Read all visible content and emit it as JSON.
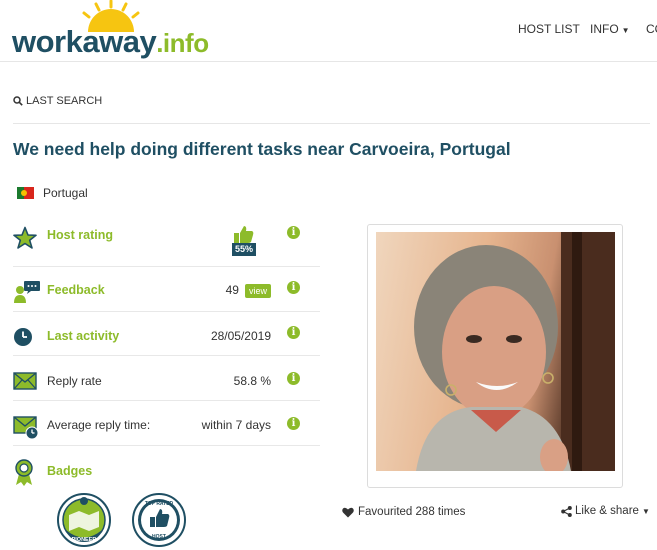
{
  "header": {
    "logo_main": "workaway",
    "logo_suffix": ".info",
    "nav": [
      {
        "label": "HOST LIST",
        "has_caret": false
      },
      {
        "label": "INFO",
        "has_caret": true
      },
      {
        "label": "CO",
        "has_caret": false
      }
    ]
  },
  "last_search": {
    "label": "LAST SEARCH",
    "icon": "search-icon"
  },
  "listing": {
    "title": "We need help doing different tasks near Carvoeira, Portugal",
    "country": "Portugal"
  },
  "stats": {
    "host_rating": {
      "label": "Host rating",
      "percent": "55%"
    },
    "feedback": {
      "label": "Feedback",
      "value": "49",
      "button": "view"
    },
    "last_activity": {
      "label": "Last activity",
      "value": "28/05/2019"
    },
    "reply_rate": {
      "label": "Reply rate",
      "value": "58.8 %"
    },
    "avg_reply": {
      "label": "Average reply time:",
      "value": "within 7 days"
    },
    "badges": {
      "label": "Badges",
      "items": [
        "PIONEER",
        "TOP RATED HOST"
      ]
    }
  },
  "photo": {
    "alt": "host-photo"
  },
  "actions": {
    "favourited": "Favourited 288 times",
    "share": "Like & share"
  },
  "colors": {
    "brand_dark": "#1f4f63",
    "brand_green": "#8dbb2a"
  }
}
